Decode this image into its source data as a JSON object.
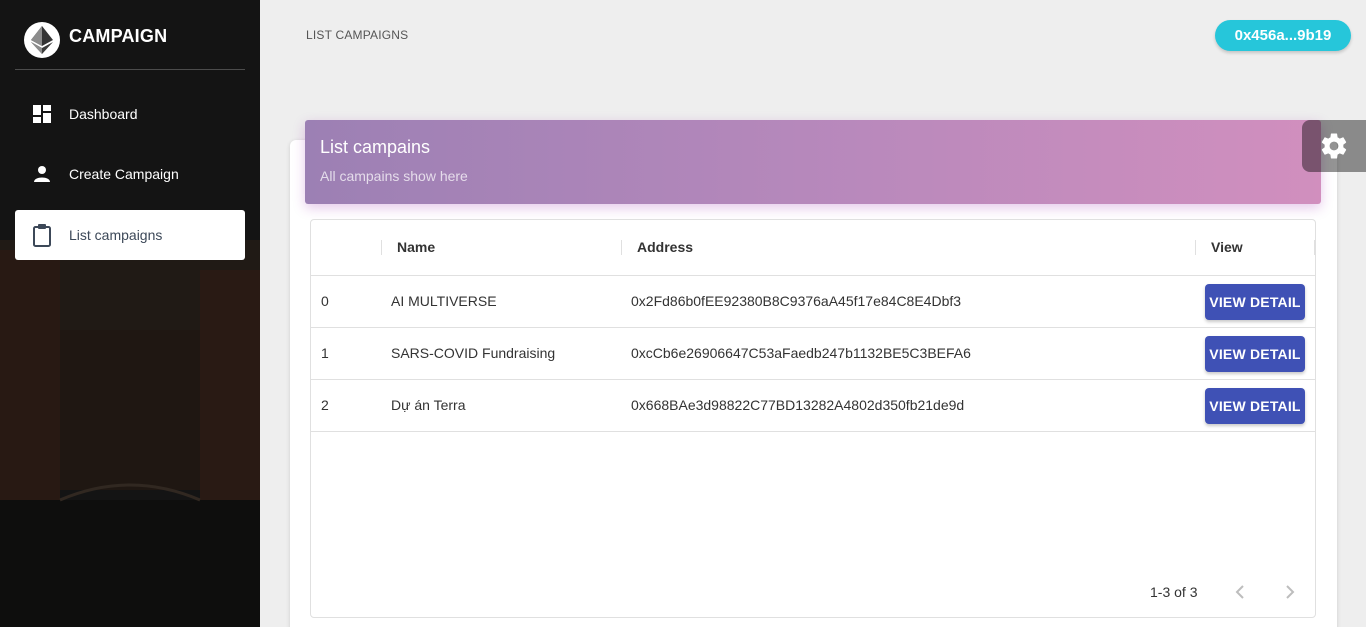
{
  "sidebar": {
    "brand": {
      "title": "CAMPAIGN",
      "logo_icon": "ethereum-logo-icon"
    },
    "items": [
      {
        "label": "Dashboard",
        "icon": "dashboard-icon",
        "active": false
      },
      {
        "label": "Create Campaign",
        "icon": "person-icon",
        "active": false
      },
      {
        "label": "List campaigns",
        "icon": "clipboard-icon",
        "active": true
      }
    ]
  },
  "header": {
    "breadcrumb": "LIST CAMPAIGNS",
    "wallet": "0x456a...9b19"
  },
  "card": {
    "title": "List campains",
    "subtitle": "All campains show here"
  },
  "table": {
    "columns": [
      "",
      "Name",
      "Address",
      "View"
    ],
    "rows": [
      {
        "id": "0",
        "name": "AI MULTIVERSE",
        "address": "0x2Fd86b0fEE92380B8C9376aA45f17e84C8E4Dbf3",
        "action": "VIEW DETAIL"
      },
      {
        "id": "1",
        "name": "SARS-COVID Fundraising",
        "address": "0xcCb6e26906647C53aFaedb247b1132BE5C3BEFA6",
        "action": "VIEW DETAIL"
      },
      {
        "id": "2",
        "name": "Dự án Terra",
        "address": "0x668BAe3d98822C77BD13282A4802d350fb21de9d",
        "action": "VIEW DETAIL"
      }
    ],
    "pagination": "1-3 of 3"
  },
  "colors": {
    "accent_wallet": "#26c6da",
    "button": "#3f51b5",
    "header_gradient_start": "#9c80b4",
    "header_gradient_end": "#d18fbe"
  }
}
